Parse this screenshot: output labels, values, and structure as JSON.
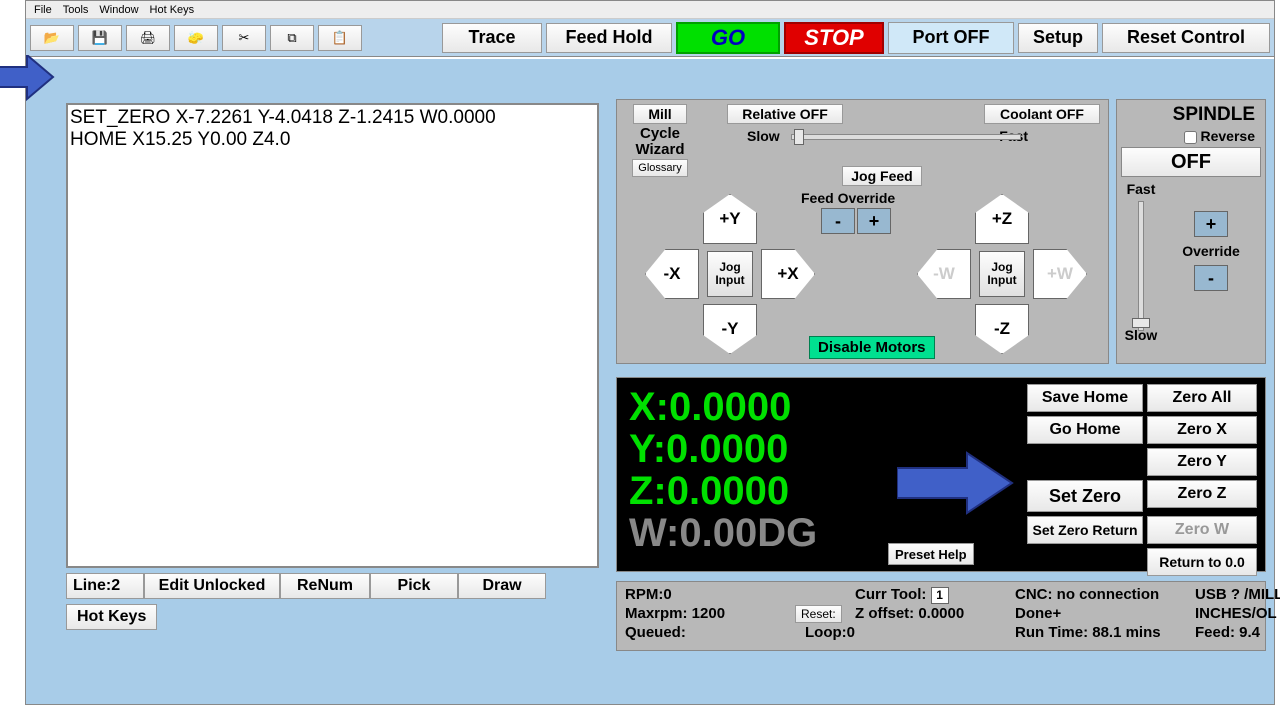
{
  "menubar": [
    "File",
    "Tools",
    "Window",
    "Hot Keys"
  ],
  "toolbar": {
    "trace": "Trace",
    "feed_hold": "Feed Hold",
    "go": "GO",
    "stop": "STOP",
    "port": "Port OFF",
    "setup": "Setup",
    "reset": "Reset Control"
  },
  "editor": {
    "line1": "SET_ZERO X-7.2261 Y-4.0418 Z-1.2415 W0.0000",
    "line2": "HOME X15.25  Y0.00 Z4.0",
    "line_label": "Line:2",
    "edit_unlocked": "Edit Unlocked",
    "renum": "ReNum",
    "pick": "Pick",
    "draw": "Draw",
    "hotkeys": "Hot Keys"
  },
  "jog": {
    "mill": "Mill",
    "cycle_wizard": "Cycle\nWizard",
    "glossary": "Glossary",
    "relative": "Relative OFF",
    "coolant": "Coolant OFF",
    "slow": "Slow",
    "fast": "Fast",
    "jog_feed": "Jog Feed",
    "feed_override": "Feed Override",
    "minus": "-",
    "plus": "+",
    "jog_input": "Jog\nInput",
    "disable_motors": "Disable Motors",
    "axes": {
      "py": "+Y",
      "my": "-Y",
      "px": "+X",
      "mx": "-X",
      "pz": "+Z",
      "mz": "-Z",
      "pw": "+W",
      "mw": "-W"
    }
  },
  "spindle": {
    "title": "SPINDLE",
    "reverse": "Reverse",
    "off": "OFF",
    "fast": "Fast",
    "slow": "Slow",
    "override": "Override",
    "plus": "+",
    "minus": "-"
  },
  "dro": {
    "x": "X:0.0000",
    "y": "Y:0.0000",
    "z": "Z:0.0000",
    "w": "W:0.00DG",
    "save_home": "Save Home",
    "go_home": "Go Home",
    "set_zero": "Set Zero",
    "set_zero_return": "Set Zero Return",
    "zero_all": "Zero All",
    "zero_x": "Zero X",
    "zero_y": "Zero Y",
    "zero_z": "Zero Z",
    "zero_w": "Zero W",
    "return00": "Return to 0.0",
    "preset_help": "Preset Help"
  },
  "status": {
    "rpm": "RPM:0",
    "maxrpm": "Maxrpm: 1200",
    "queued": "Queued:",
    "reset": "Reset:",
    "loop": "Loop:0",
    "curr_tool_label": "Curr Tool:",
    "curr_tool_val": "1",
    "z_offset": "Z offset: 0.0000",
    "cnc": "CNC: no connection",
    "done": "Done+",
    "runtime": "Run Time: 88.1 mins",
    "usb": "USB ? /MILL",
    "units": "INCHES/OL",
    "feed": "Feed: 9.4"
  }
}
